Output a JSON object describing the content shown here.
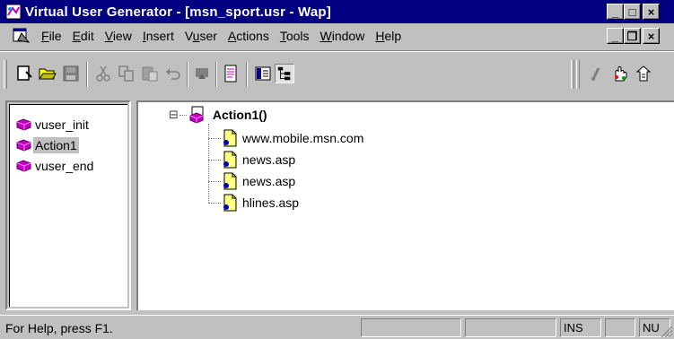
{
  "window": {
    "title": "Virtual User Generator - [msn_sport.usr - Wap]",
    "minimize": "_",
    "maximize": "□",
    "close": "×"
  },
  "menubar": {
    "items": [
      {
        "label": "File",
        "accel": "F",
        "rest": "ile"
      },
      {
        "label": "Edit",
        "accel": "E",
        "rest": "dit"
      },
      {
        "label": "View",
        "accel": "V",
        "rest": "iew"
      },
      {
        "label": "Insert",
        "accel": "I",
        "rest": "nsert"
      },
      {
        "label": "Vuser",
        "pre": "V",
        "accel": "u",
        "rest": "ser"
      },
      {
        "label": "Actions",
        "accel": "A",
        "rest": "ctions"
      },
      {
        "label": "Tools",
        "accel": "T",
        "rest": "ools"
      },
      {
        "label": "Window",
        "accel": "W",
        "rest": "indow"
      },
      {
        "label": "Help",
        "accel": "H",
        "rest": "elp"
      }
    ],
    "doc_minimize": "_",
    "doc_restore": "❐",
    "doc_close": "×"
  },
  "actions": [
    {
      "label": "vuser_init",
      "selected": false
    },
    {
      "label": "Action1",
      "selected": true
    },
    {
      "label": "vuser_end",
      "selected": false
    }
  ],
  "tree": {
    "root": "Action1()",
    "collapse_glyph": "⊟",
    "steps": [
      "www.mobile.msn.com",
      "news.asp",
      "news.asp",
      "hlines.asp"
    ]
  },
  "status": {
    "help": "For Help, press F1.",
    "ins": "INS",
    "num": "NU"
  },
  "colors": {
    "title_bar": "#000080",
    "face": "#c0c0c0",
    "action_icon": "#c000c0",
    "step_icon": "#ffff80"
  }
}
